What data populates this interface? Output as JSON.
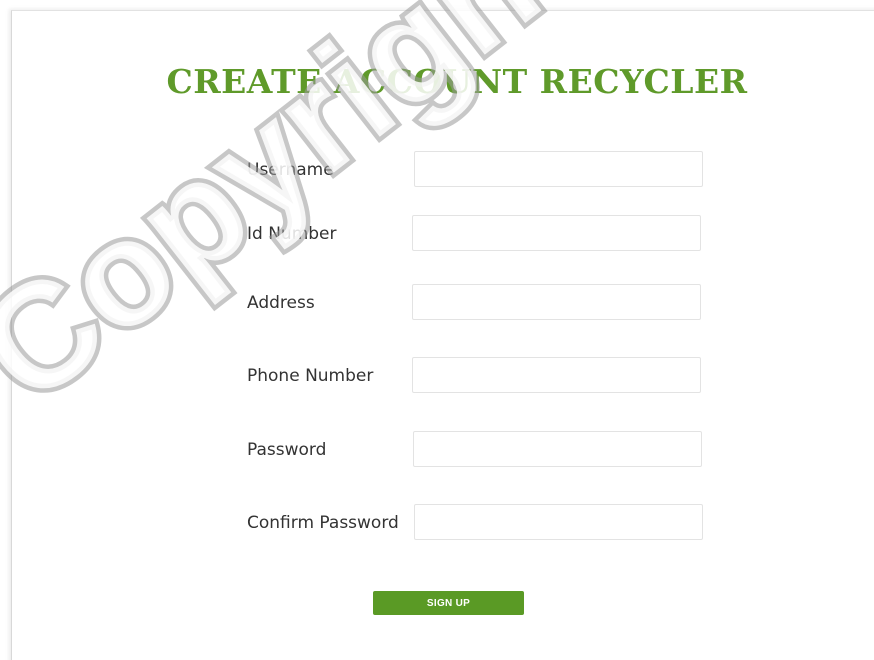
{
  "form": {
    "title": "CREATE ACCOUNT RECYCLER",
    "fields": [
      {
        "label": "Username",
        "value": "",
        "placeholder": ""
      },
      {
        "label": "Id Number",
        "value": "",
        "placeholder": ""
      },
      {
        "label": "Address",
        "value": "",
        "placeholder": ""
      },
      {
        "label": "Phone Number",
        "value": "",
        "placeholder": ""
      },
      {
        "label": "Password",
        "value": "",
        "placeholder": ""
      },
      {
        "label": "Confirm Password",
        "value": "",
        "placeholder": ""
      }
    ],
    "submit_label": "SIGN UP"
  },
  "watermark": {
    "text": "Copyright"
  },
  "colors": {
    "accent": "#5f9a2a",
    "button": "#5a9a25",
    "label": "#333333"
  }
}
